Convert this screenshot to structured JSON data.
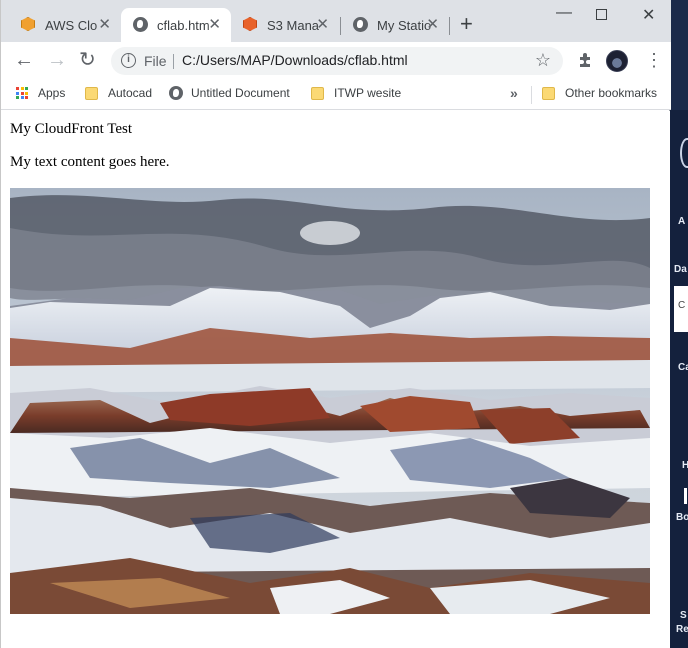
{
  "tabs": [
    {
      "title": "AWS Clo",
      "icon": "aws-cube-icon",
      "active": false
    },
    {
      "title": "cflab.htm",
      "icon": "globe-icon",
      "active": true
    },
    {
      "title": "S3 Mana",
      "icon": "s3-cube-icon",
      "active": false
    },
    {
      "title": "My Statio",
      "icon": "globe-icon",
      "active": false
    }
  ],
  "toolbar": {
    "scheme_label": "File",
    "url": "C:/Users/MAP/Downloads/cflab.html"
  },
  "bookmarks": {
    "items": [
      {
        "label": "Apps",
        "icon": "apps-grid-icon"
      },
      {
        "label": "Autocad",
        "icon": "folder-icon"
      },
      {
        "label": "Untitled Document",
        "icon": "globe-icon"
      },
      {
        "label": "ITWP wesite",
        "icon": "folder-icon"
      }
    ],
    "overflow_label": "»",
    "other_label": "Other bookmarks"
  },
  "page": {
    "heading": "My CloudFront Test",
    "text": "My text content goes here.",
    "image_subject": "snow-dusted canyon landscape under cloudy sky"
  },
  "background_app": {
    "fragments": [
      "A",
      "Da",
      "C",
      "Ca",
      "H",
      "Bo",
      "S",
      "Re"
    ]
  },
  "colors": {
    "titlebar": "#dee1e6",
    "active_tab": "#ffffff",
    "background_app": "#14213d"
  }
}
